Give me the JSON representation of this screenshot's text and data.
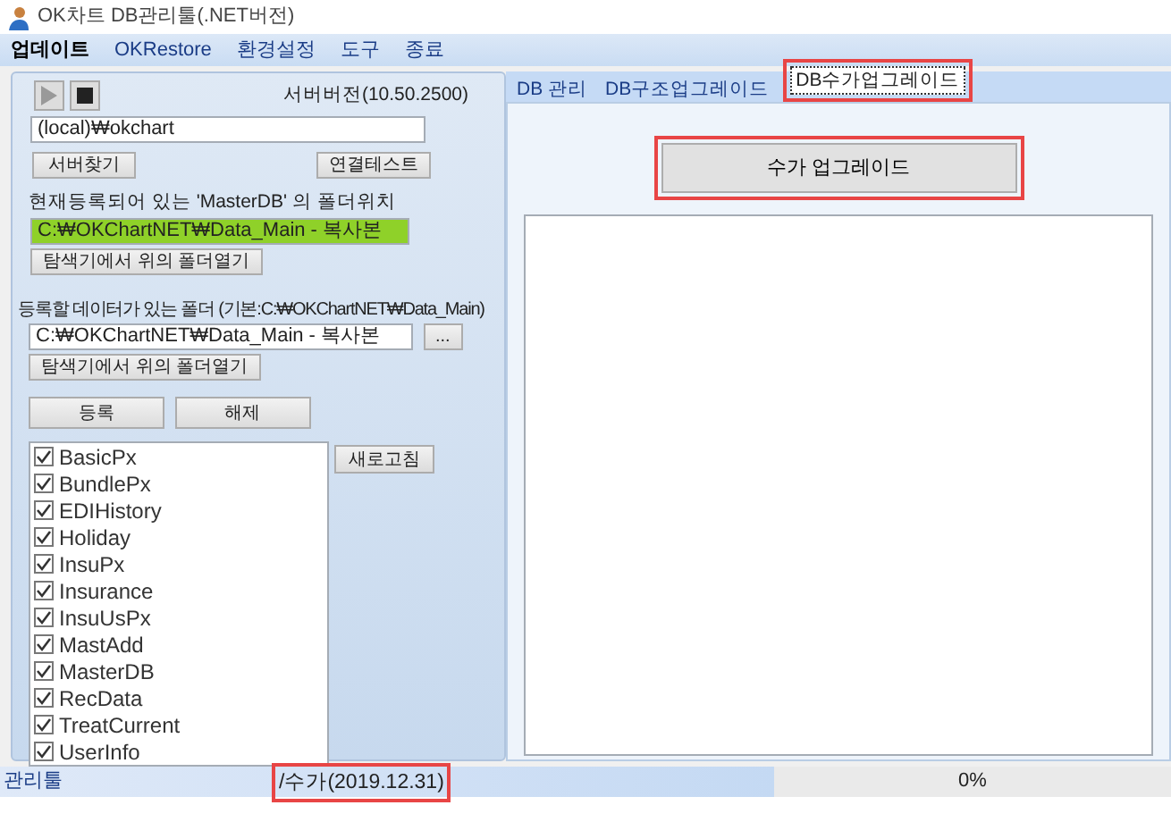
{
  "window": {
    "title": "OK차트 DB관리툴(.NET버전)"
  },
  "menu": [
    {
      "label": "업데이트",
      "selected": true
    },
    {
      "label": "OKRestore",
      "selected": false
    },
    {
      "label": "환경설정",
      "selected": false
    },
    {
      "label": "도구",
      "selected": false
    },
    {
      "label": "종료",
      "selected": false
    }
  ],
  "left_panel": {
    "play": {
      "disabled": true
    },
    "server_version": "서버버전(10.50.2500)",
    "server_field": "(local)₩okchart",
    "find_server_button": "서버찾기",
    "connection_test_button": "연결테스트",
    "masterdb_label": "현재등록되어 있는 'MasterDB' 의 폴더위치",
    "masterdb_path": "C:₩OKChartNET₩Data_Main - 복사본",
    "open_folder_button_1": "탐색기에서 위의 폴더열기",
    "data_folder_label": "등록할 데이터가 있는 폴더 (기본:C:₩OKChartNET₩Data_Main)",
    "data_folder_path": "C:₩OKChartNET₩Data_Main - 복사본",
    "browse_button": "...",
    "open_folder_button_2": "탐색기에서 위의 폴더열기",
    "register_button": "등록",
    "unregister_button": "해제",
    "refresh_button": "새로고침",
    "databases": [
      {
        "label": "BasicPx",
        "checked": true
      },
      {
        "label": "BundlePx",
        "checked": true
      },
      {
        "label": "EDIHistory",
        "checked": true
      },
      {
        "label": "Holiday",
        "checked": true
      },
      {
        "label": "InsuPx",
        "checked": true
      },
      {
        "label": "Insurance",
        "checked": true
      },
      {
        "label": "InsuUsPx",
        "checked": true
      },
      {
        "label": "MastAdd",
        "checked": true
      },
      {
        "label": "MasterDB",
        "checked": true
      },
      {
        "label": "RecData",
        "checked": true
      },
      {
        "label": "TreatCurrent",
        "checked": true
      },
      {
        "label": "UserInfo",
        "checked": true
      }
    ]
  },
  "tabs": [
    {
      "label": "DB 관리",
      "selected": false,
      "highlighted": false
    },
    {
      "label": "DB구조업그레이드",
      "selected": false,
      "highlighted": false
    },
    {
      "label": "DB수가업그레이드",
      "selected": true,
      "highlighted": true
    }
  ],
  "upgrade_button": {
    "label": "수가 업그레이드",
    "highlighted": true
  },
  "status_bar": {
    "label": "관리툴",
    "message": "/수가(2019.12.31)",
    "message_highlighted": true,
    "progress": {
      "level": 0,
      "reading": "0%"
    }
  }
}
